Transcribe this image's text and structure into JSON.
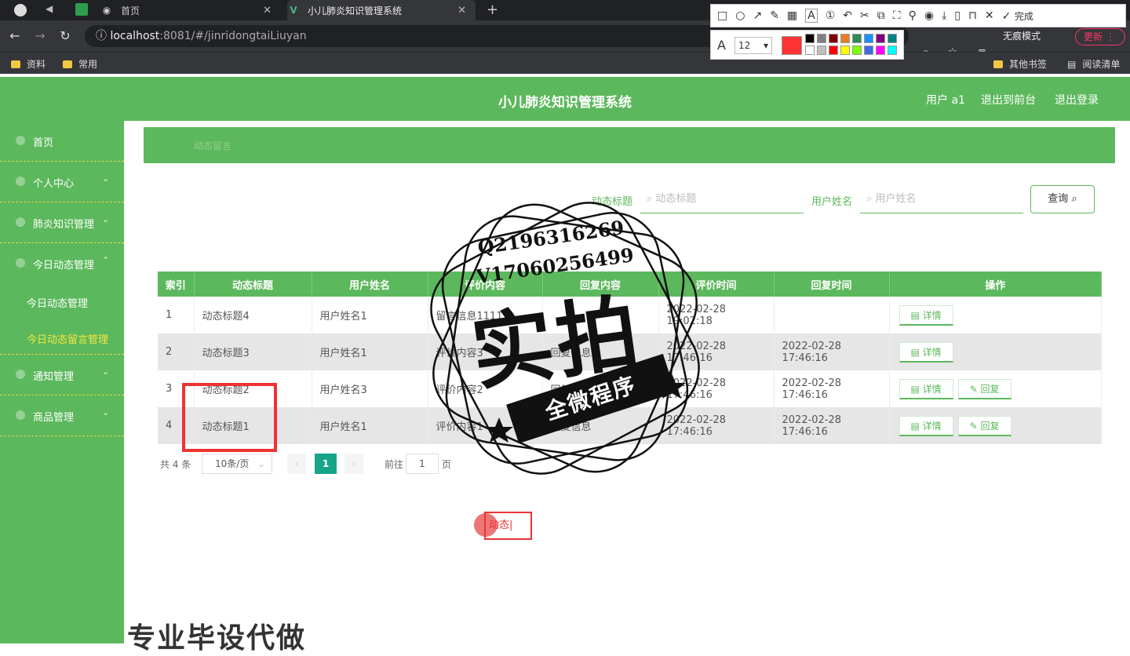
{
  "browser": {
    "tabs": [
      {
        "label": "首页"
      },
      {
        "label": "小儿肺炎知识管理系统"
      }
    ],
    "url_host": "localhost",
    "url_rest": ":8081/#/jinridongtaiLiuyan",
    "bookmarks": [
      "资料",
      "常用"
    ],
    "bookmarks_right": [
      "其他书签",
      "阅读清单"
    ],
    "incognito_label": "无痕模式",
    "update_label": "更新"
  },
  "snip_tool": {
    "done_label": "完成",
    "font_size": "12",
    "current_color": "#ff3333",
    "palette": [
      "#000000",
      "#808080",
      "#800000",
      "#e67e22",
      "#2e8b57",
      "#1e90ff",
      "#800080",
      "#008080",
      "#ffffff",
      "#c0c0c0",
      "#ff0000",
      "#ffff00",
      "#7fff00",
      "#4169e1",
      "#ff00ff",
      "#00ffff"
    ]
  },
  "app": {
    "title": "小儿肺炎知识管理系统",
    "user_label": "用户 a1",
    "back_front_label": "退出到前台",
    "logout_label": "退出登录"
  },
  "sidebar": {
    "items": [
      {
        "label": "首页",
        "arrow": ""
      },
      {
        "label": "个人中心",
        "arrow": "⌄"
      },
      {
        "label": "肺炎知识管理",
        "arrow": "⌄"
      },
      {
        "label": "今日动态管理",
        "arrow": "⌃"
      },
      {
        "label": "通知管理",
        "arrow": "⌄"
      },
      {
        "label": "商品管理",
        "arrow": "⌄"
      }
    ],
    "sub_items": [
      "今日动态管理",
      "今日动态留言管理"
    ]
  },
  "main": {
    "breadcrumb": "动态留言",
    "search": {
      "title_label": "动态标题",
      "title_placeholder": "动态标题",
      "user_label": "用户姓名",
      "user_placeholder": "用户姓名",
      "query_button": "查询"
    },
    "table": {
      "headers": [
        "索引",
        "动态标题",
        "用户姓名",
        "评价内容",
        "回复内容",
        "评价时间",
        "回复时间",
        "操作"
      ],
      "rows": [
        {
          "index": "1",
          "title": "动态标题4",
          "user": "用户姓名1",
          "comment": "留言信息1111",
          "reply": "",
          "comment_time": "2022-02-28 19:02:18",
          "reply_time": ""
        },
        {
          "index": "2",
          "title": "动态标题3",
          "user": "用户姓名1",
          "comment": "评价内容3",
          "reply": "回复信息",
          "comment_time": "2022-02-28 17:46:16",
          "reply_time": "2022-02-28 17:46:16"
        },
        {
          "index": "3",
          "title": "动态标题2",
          "user": "用户姓名3",
          "comment": "评价内容2",
          "reply": "回复信息",
          "comment_time": "2022-02-28 17:46:16",
          "reply_time": "2022-02-28 17:46:16"
        },
        {
          "index": "4",
          "title": "动态标题1",
          "user": "用户姓名1",
          "comment": "评价内容1",
          "reply": "回复信息",
          "comment_time": "2022-02-28 17:46:16",
          "reply_time": "2022-02-28 17:46:16"
        }
      ],
      "detail_label": "详情",
      "reply_label": "回复"
    },
    "pager": {
      "total": "共 4 条",
      "page_size": "10条/页",
      "current_page": "1",
      "goto_label": "前往",
      "goto_value": "1",
      "page_suffix": "页"
    },
    "typing_text": "动态"
  },
  "watermark": {
    "qq": "Q2196316269",
    "vx": "V17060256499",
    "big": "实拍",
    "ribbon": "全微程序"
  },
  "bottom_promo": "专业毕设代做"
}
